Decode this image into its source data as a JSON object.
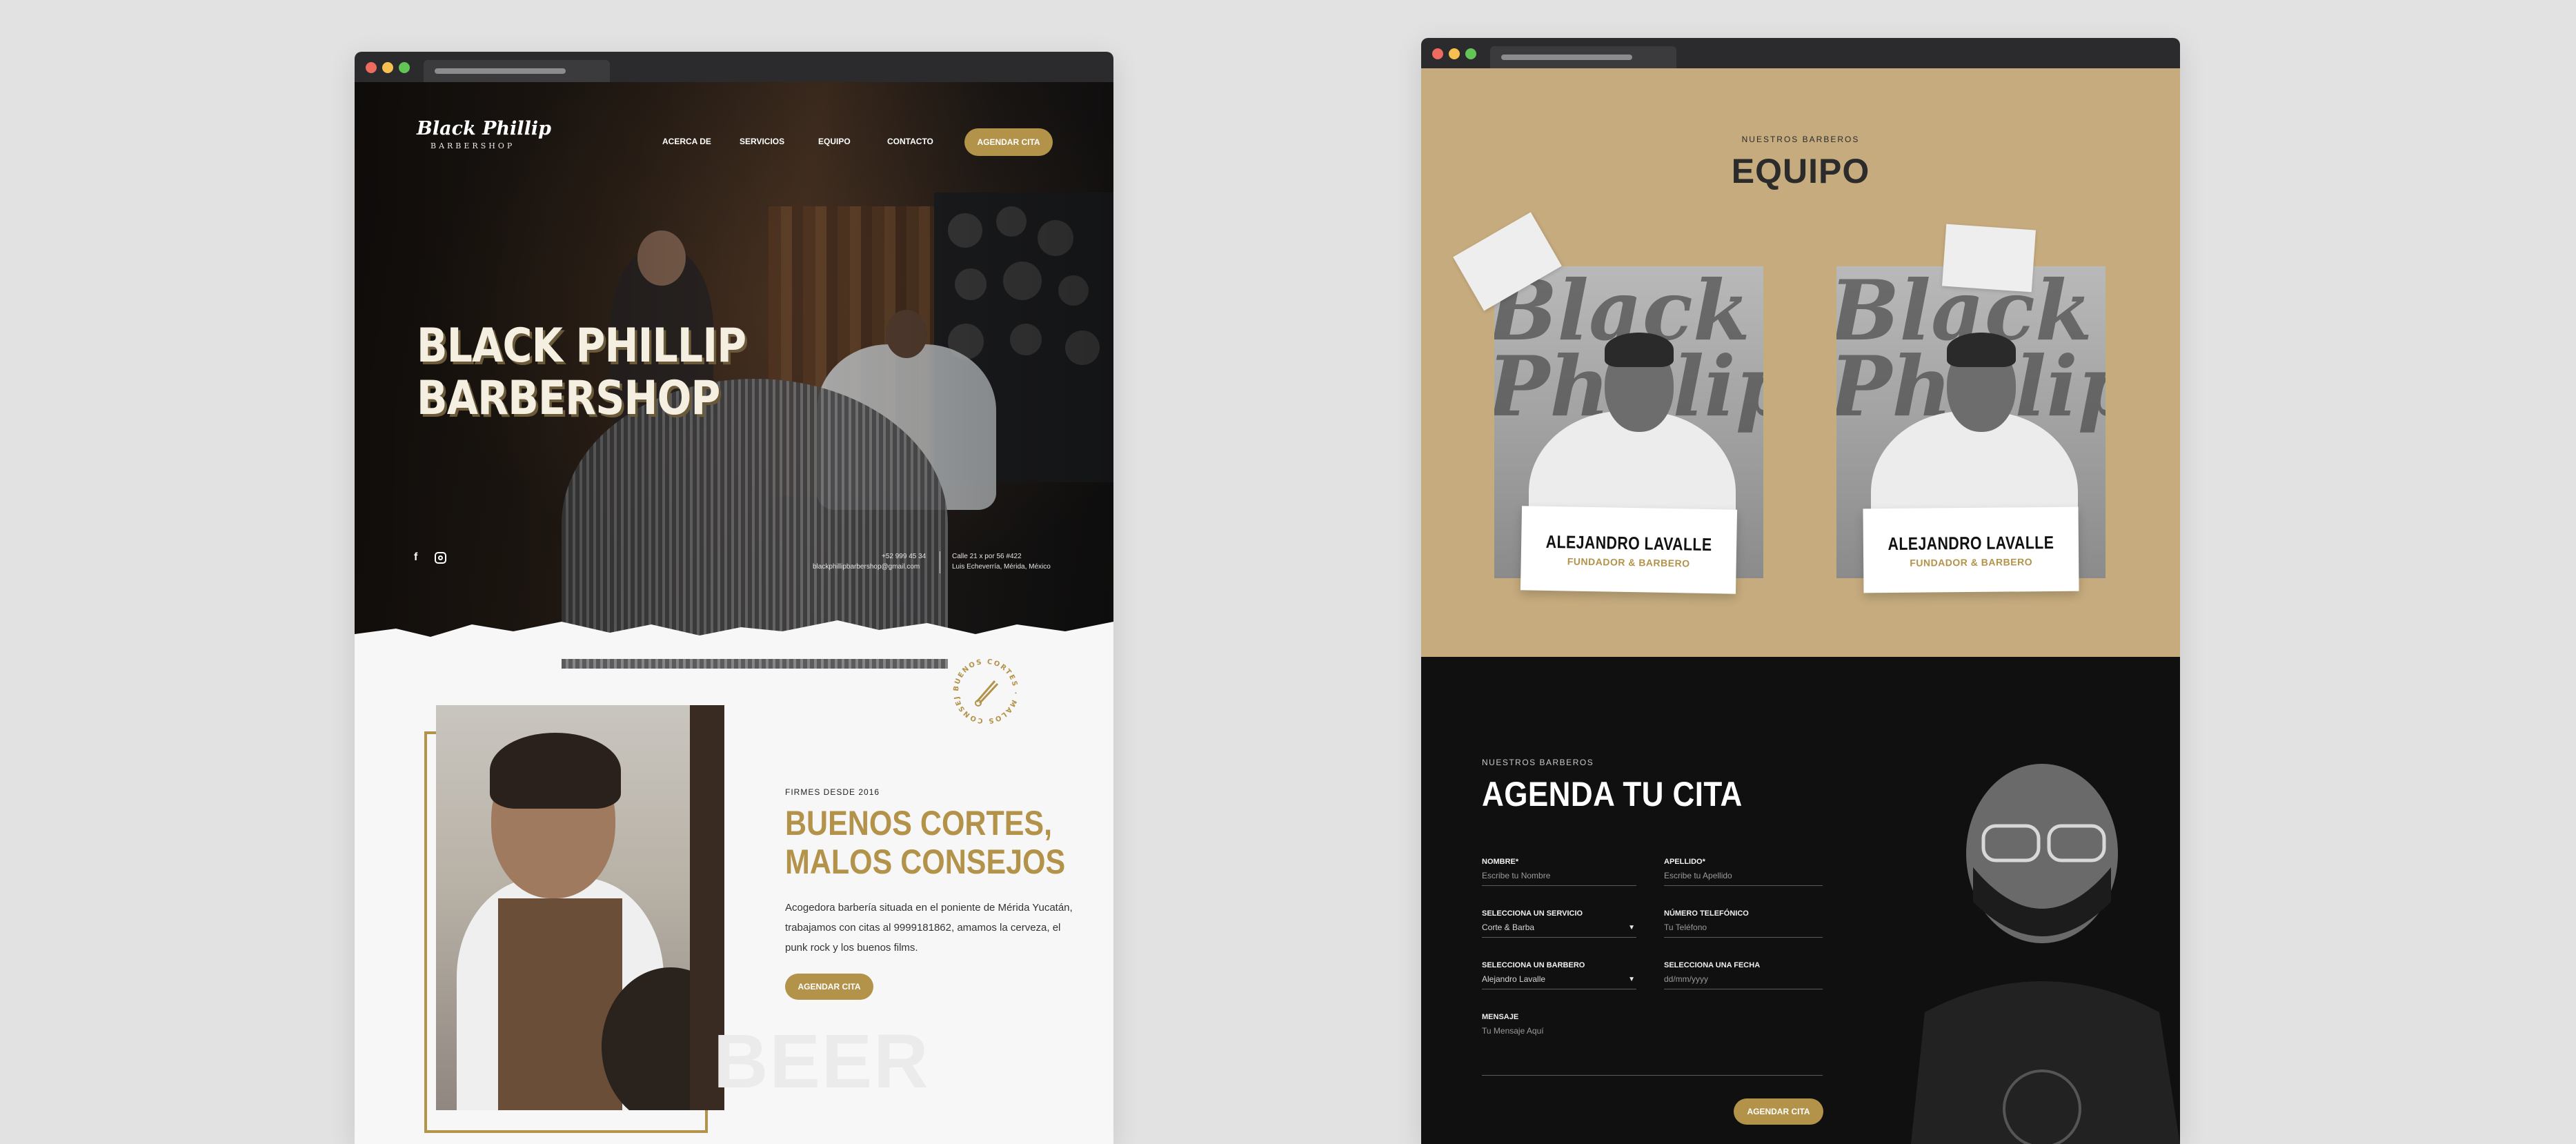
{
  "left_window": {
    "header": {
      "logo_main": "Black Phillip",
      "logo_sub": "BARBERSHOP",
      "nav": [
        "ACERCA DE",
        "SERVICIOS",
        "EQUIPO",
        "CONTACTO"
      ],
      "cta": "AGENDAR CITA"
    },
    "hero": {
      "title_line1": "BLACK PHILLIP",
      "title_line2": "BARBERSHOP",
      "social_icons": [
        "facebook-icon",
        "instagram-icon"
      ],
      "phone": "+52 999 45 34",
      "email": "blackphillipbarbershop@gmail.com",
      "address_line1": "Calle 21 x por 56 #422",
      "address_line2": "Luis Echeverría, Mérida, México"
    },
    "about": {
      "badge_text": "BUENOS CORTES · MALOS CONSEJOS ·",
      "eyebrow": "FIRMES DESDE 2016",
      "title_line1": "BUENOS CORTES,",
      "title_line2": "MALOS CONSEJOS",
      "body": "Acogedora barbería situada en el poniente de Mérida Yucatán, trabajamos con citas al 9999181862, amamos la cerveza, el punk rock y los buenos films.",
      "cta": "AGENDAR CITA",
      "watermark": "BEER"
    }
  },
  "right_window": {
    "team": {
      "eyebrow": "NUESTROS BARBEROS",
      "title": "EQUIPO",
      "members": [
        {
          "name": "ALEJANDRO LAVALLE",
          "role": "FUNDADOR & BARBERO"
        },
        {
          "name": "ALEJANDRO LAVALLE",
          "role": "FUNDADOR & BARBERO"
        }
      ]
    },
    "form": {
      "eyebrow": "NUESTROS BARBEROS",
      "title": "AGENDA TU CITA",
      "fields": {
        "nombre": {
          "label": "NOMBRE*",
          "placeholder": "Escribe tu Nombre"
        },
        "apellido": {
          "label": "APELLIDO*",
          "placeholder": "Escribe tu Apellido"
        },
        "servicio": {
          "label": "SELECCIONA UN SERVICIO",
          "value": "Corte & Barba"
        },
        "telefono": {
          "label": "NÚMERO TELEFÓNICO",
          "placeholder": "Tu Teléfono"
        },
        "barbero": {
          "label": "SELECCIONA UN BARBERO",
          "value": "Alejandro Lavalle"
        },
        "fecha": {
          "label": "SELECCIONA UNA FECHA",
          "placeholder": "dd/mm/yyyy"
        },
        "mensaje": {
          "label": "MENSAJE",
          "placeholder": "Tu Mensaje Aquí"
        }
      },
      "submit": "AGENDAR CITA"
    }
  },
  "colors": {
    "gold": "#b3924a",
    "tan": "#c5ab7d",
    "dark": "#101010",
    "chrome": "#2b2b2d",
    "traffic_red": "#ed6b5f",
    "traffic_yellow": "#f5c04f",
    "traffic_green": "#62c555"
  }
}
